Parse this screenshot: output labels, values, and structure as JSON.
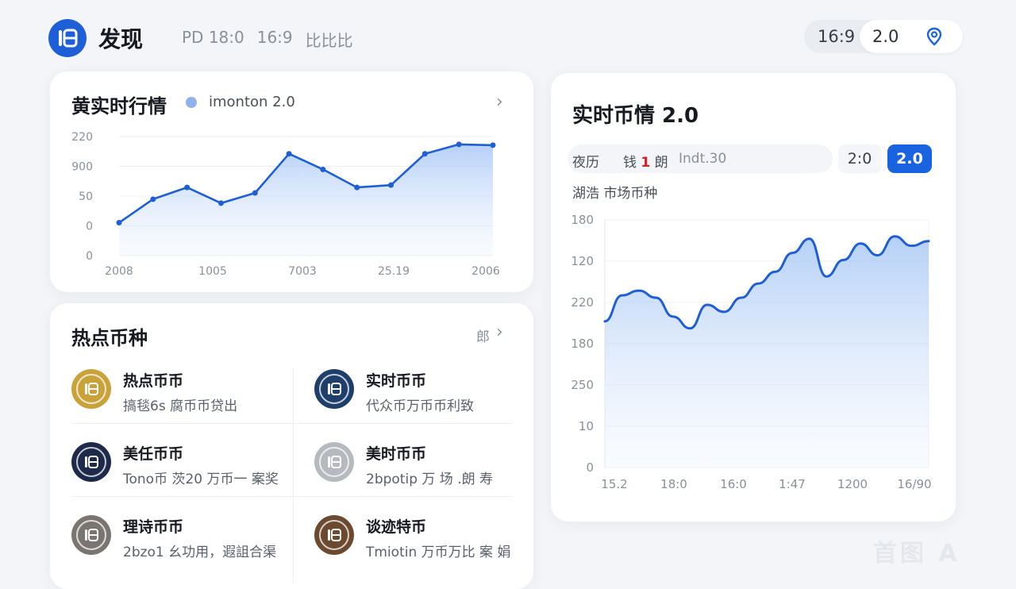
{
  "header": {
    "app_title": "发现",
    "meta": [
      "PD 18:0",
      "16:9",
      "比比比"
    ],
    "ratio": "16:9",
    "version": "2.0"
  },
  "market_card": {
    "title": "黄实时行情",
    "legend": "imonton 2.0"
  },
  "hot_card": {
    "title": "热点币种",
    "more": "郎",
    "coins": [
      {
        "name": "热点币币",
        "desc": "搞毯6s 腐币币贷出",
        "color": "#c9a23a"
      },
      {
        "name": "实时币币",
        "desc": "代众币万币币利致",
        "color": "#1f3f6b"
      },
      {
        "name": "美任币币",
        "desc": "Tono币 茨20 万币一 案奖",
        "color": "#1d2a4a"
      },
      {
        "name": "美时币币",
        "desc": "2bpotip 万 场 .朗 寿",
        "color": "#b6b9be"
      },
      {
        "name": "理诗币币",
        "desc": "2bzo1 幺功用，遐詛合渠",
        "color": "#7a7570"
      },
      {
        "name": "谈迹特币",
        "desc": "Tmiotin 万币万比  案 娟",
        "color": "#6b4a30"
      }
    ]
  },
  "right_card": {
    "title": "实时币情 2.0",
    "filter_a": "夜历",
    "filter_b": "钱",
    "filter_b_num": "1",
    "filter_b_tail": "朗",
    "filter_c": "Indt.30",
    "seg_a": "2:0",
    "seg_b": "2.0",
    "sub_label": "湖浩  市场币种"
  },
  "chart_data": [
    {
      "type": "area",
      "x": [
        "2008",
        "1005",
        "7003",
        "25.19",
        "2006"
      ],
      "y_ticks": [
        "0",
        "0",
        "50",
        "900",
        "220"
      ],
      "values": [
        12,
        42,
        57,
        37,
        50,
        100,
        80,
        57,
        60,
        100,
        112,
        111
      ]
    },
    {
      "type": "area",
      "x": [
        "15.2",
        "18:0",
        "16:0",
        "1:47",
        "1200",
        "16/90"
      ],
      "y_ticks": [
        "0",
        "10",
        "250",
        "180",
        "220",
        "120",
        "180"
      ],
      "values": [
        0.62,
        0.73,
        0.75,
        0.72,
        0.64,
        0.59,
        0.69,
        0.66,
        0.72,
        0.78,
        0.83,
        0.91,
        0.97,
        0.81,
        0.88,
        0.95,
        0.9,
        0.98,
        0.94,
        0.96
      ]
    }
  ]
}
